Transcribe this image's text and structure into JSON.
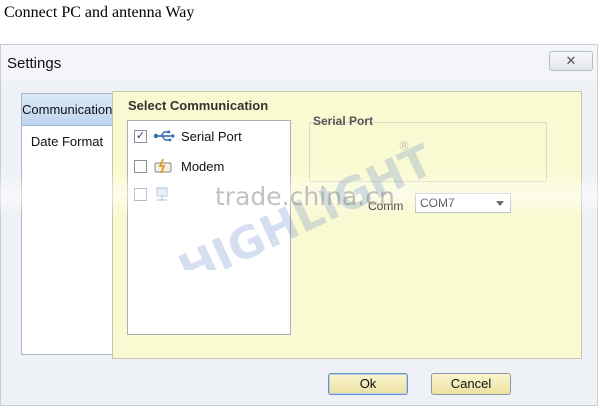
{
  "caption": "Connect PC and antenna Way",
  "dialog": {
    "title": "Settings",
    "close_glyph": "✕"
  },
  "tabs": [
    {
      "label": "Communication",
      "active": true
    },
    {
      "label": "Date Format",
      "active": false
    }
  ],
  "panel": {
    "group_title": "Select Communication",
    "items": [
      {
        "label": "Serial Port",
        "checked": true,
        "icon": "usb-icon"
      },
      {
        "label": "Modem",
        "checked": false,
        "icon": "modem-icon"
      },
      {
        "label": "",
        "checked": false,
        "icon": "network-icon"
      }
    ],
    "serial": {
      "title": "Serial Port",
      "comm_label": "Comm",
      "comm_value": "COM7"
    }
  },
  "buttons": {
    "ok": "Ok",
    "cancel": "Cancel"
  },
  "watermark": {
    "text": "trade.china.cn",
    "logo_text": "HIGHLIGHT",
    "registered": "®"
  },
  "colors": {
    "panel_bg": "#fafad2",
    "button_bg": "#ece0a0",
    "tab_active": "#bfd6ef"
  }
}
